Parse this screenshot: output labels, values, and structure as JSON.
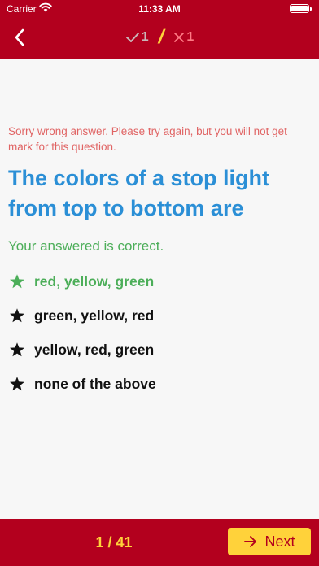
{
  "status_bar": {
    "carrier": "Carrier",
    "time": "11:33 AM"
  },
  "header": {
    "correct_count": "1",
    "wrong_count": "1",
    "divider": "/"
  },
  "question_panel": {
    "wrong_message": "Sorry wrong answer. Please try again, but you will not get mark for this question.",
    "question": "The colors of a stop light from top to bottom are",
    "result_message": "Your answered is correct.",
    "options": [
      {
        "label": "red, yellow, green",
        "state": "correct"
      },
      {
        "label": "green, yellow, red",
        "state": "normal"
      },
      {
        "label": "yellow, red, green",
        "state": "normal"
      },
      {
        "label": "none of the above",
        "state": "normal"
      }
    ]
  },
  "footer": {
    "page": "1 / 41",
    "next_label": "Next"
  },
  "colors": {
    "brand": "#b3001e",
    "accent": "#ffd23a",
    "question": "#2b8fd6",
    "correct": "#4cae59",
    "wrong": "#e06464"
  }
}
